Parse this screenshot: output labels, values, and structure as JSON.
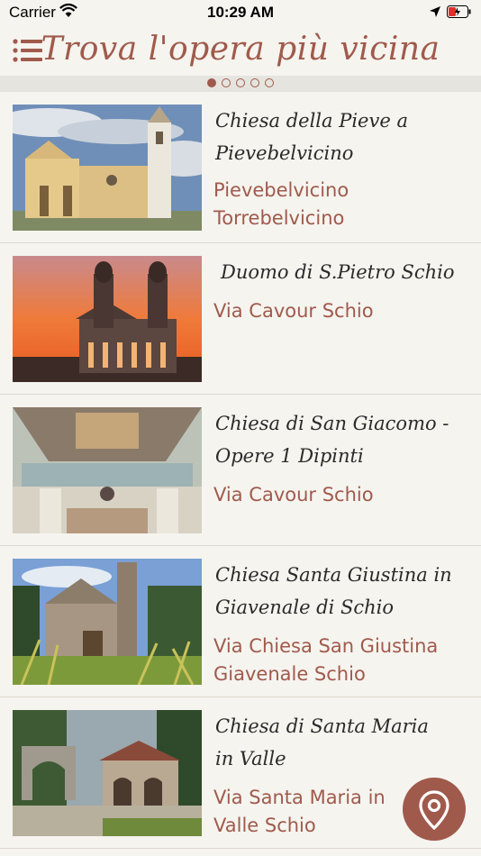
{
  "status_bar": {
    "carrier": "Carrier",
    "time": "10:29 AM"
  },
  "header": {
    "title": "Trova l'opera più vicina",
    "menu_icon": "menu-icon"
  },
  "pager": {
    "pages": 5,
    "active": 0
  },
  "items": [
    {
      "name": "Chiesa della Pieve a Pievebelvicino",
      "address": "Pievebelvicino Torrebelvicino"
    },
    {
      "name": "Duomo di S.Pietro Schio",
      "address": "Via Cavour Schio"
    },
    {
      "name": "Chiesa di San Giacomo - Opere 1 Dipinti",
      "address": "Via Cavour Schio"
    },
    {
      "name": "Chiesa Santa Giustina in Giavenale di Schio",
      "address": "Via Chiesa San Giustina Giavenale Schio"
    },
    {
      "name": "Chiesa di Santa Maria in Valle",
      "address": "Via Santa Maria in Valle Schio"
    }
  ],
  "fab": {
    "icon": "map-pin-icon"
  },
  "colors": {
    "accent": "#a05a4c",
    "background": "#f5f4ef"
  }
}
